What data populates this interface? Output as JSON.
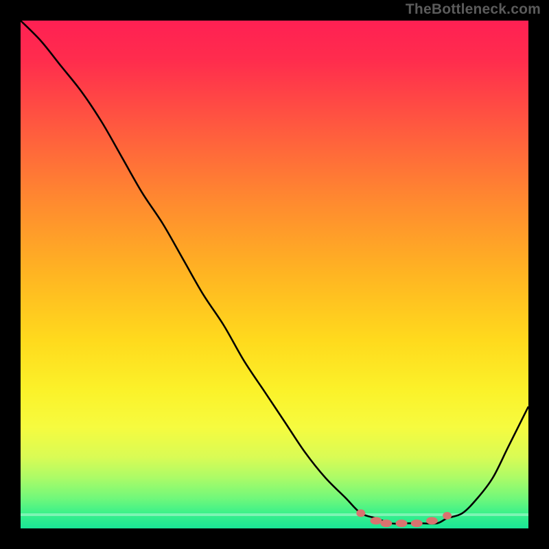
{
  "watermark": "TheBottleneck.com",
  "colors": {
    "background": "#000000",
    "curve_stroke": "#000000",
    "dot_fill": "#d9736f",
    "gradient_stops": [
      "#ff2053",
      "#ff2d4d",
      "#ff5d3e",
      "#ff8b2f",
      "#ffb522",
      "#ffda1d",
      "#fbf22a",
      "#f6fb3f",
      "#d9fb55",
      "#acfb67",
      "#72f87a",
      "#3bf18a",
      "#1ae696"
    ]
  },
  "chart_data": {
    "type": "line",
    "title": "",
    "xlabel": "",
    "ylabel": "",
    "xlim": [
      0,
      100
    ],
    "ylim": [
      0,
      100
    ],
    "grid": false,
    "legend": false,
    "series": [
      {
        "name": "bottleneck-curve",
        "x": [
          0,
          4,
          8,
          12,
          16,
          20,
          24,
          28,
          32,
          36,
          40,
          44,
          48,
          52,
          56,
          60,
          64,
          67,
          70,
          73,
          76,
          79,
          82,
          84,
          87,
          90,
          93,
          96,
          100
        ],
        "y": [
          100,
          96,
          91,
          86,
          80,
          73,
          66,
          60,
          53,
          46,
          40,
          33,
          27,
          21,
          15,
          10,
          6,
          3,
          2,
          1,
          1,
          1,
          1,
          2,
          3,
          6,
          10,
          16,
          24
        ]
      }
    ],
    "markers": {
      "name": "optimal-range-dots",
      "x": [
        67,
        70,
        72,
        75,
        78,
        81,
        84
      ],
      "y": [
        3,
        1.5,
        1,
        1,
        1,
        1.5,
        2.5
      ]
    }
  }
}
